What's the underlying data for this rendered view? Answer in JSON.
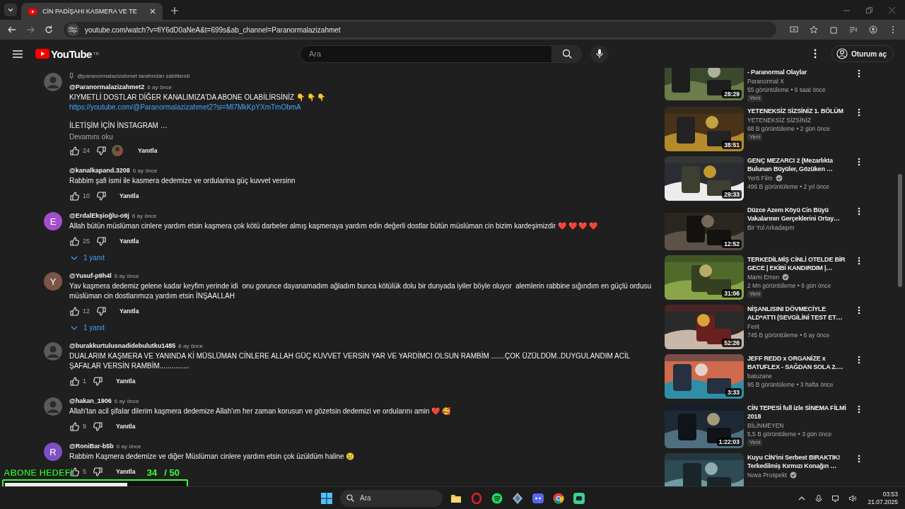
{
  "browser": {
    "tabs": [
      {
        "title": "CİN PADİŞAHI KASMERA VE TE",
        "selected": true
      }
    ],
    "url": "youtube.com/watch?v=fiY6dD0aNeA&t=699s&ab_channel=Paranormalazizahmet"
  },
  "header": {
    "logo": "YouTube",
    "region": "TR",
    "search": {
      "placeholder": "Ara"
    },
    "sign_in": "Oturum aç"
  },
  "comments": [
    {
      "pinned": "@paranormalazizahmet tarafından sabitlendi",
      "author": "@Paranormalazizahmet2",
      "age": "6 ay önce",
      "lines": [
        {
          "kind": "text",
          "text": "KIYMETLİ DOSTLAR DİĞER KANALIMIZA'DA ABONE OLABİLİRSİNİZ 👇 👇 👇"
        },
        {
          "kind": "link",
          "text": "https://youtube.com/@Paranormalazizahmet2?si=Ml7MkKpYXmTmObmA"
        },
        {
          "kind": "text",
          "text": "İLETİŞİM İÇİN İNSTAGRAM …",
          "gap_before": true
        }
      ],
      "more": "Devamını oku",
      "likes": "24",
      "creator_heart": true,
      "reply": "Yanıtla"
    },
    {
      "author": "@kanalkapand.3208",
      "age": "6 ay önce",
      "lines": [
        {
          "kind": "text",
          "text": "Rabbim şafi ismi ile kasmera dedemize ve ordularina güç kuvvet versinn"
        }
      ],
      "likes": "10",
      "creator_heart": false,
      "reply": "Yanıtla"
    },
    {
      "avatar": {
        "kind": "letter",
        "letter": "E",
        "color": "#a34fcb"
      },
      "author": "@ErdalEkşioğlu-o9j",
      "age": "6 ay önce",
      "lines": [
        {
          "kind": "text",
          "text": "Allah bütün müslüman cinlere yardım etsin kaşmera çok kötü darbeler almış kaşmeraya yardım edin değerli dostlar bütün müslüman cin bizim kardeşimizdir ❤️ ❤️ ❤️ ❤️"
        }
      ],
      "likes": "25",
      "creator_heart": false,
      "reply": "Yanıtla",
      "replies": "1 yanıt"
    },
    {
      "avatar": {
        "kind": "letter",
        "letter": "Y",
        "color": "#7a5548"
      },
      "author": "@Yusuf-p9h4l",
      "age": "6 ay önce",
      "lines": [
        {
          "kind": "text",
          "text": "Yav kaşmera dedemiz gelene kadar keyfim yerinde idi  onu gorunce dayanamadım ağladım bunca kötülük dolu bir dunyada iyiler böyle oluyor  alemlerin rabbine sığındım en güçlü ordusu müslüman cin dostlarımıza yardım etsin İNŞAALLAH"
        }
      ],
      "likes": "12",
      "creator_heart": false,
      "reply": "Yanıtla",
      "replies": "1 yanıt"
    },
    {
      "author": "@burakkurtulusnadidebulutku1485",
      "age": "6 ay önce",
      "lines": [
        {
          "kind": "text",
          "text": "DUALARIM KAŞMERA VE YANINDA Kİ MÜSLÜMAN CİNLERE ALLAH GÜÇ KUVVET VERSİN YAR VE YARDİMCI OLSUN RAMBİM .......ÇOK ÜZÜLDÜM..DUYGULANDIM ACİL ŞAFALAR VERSİN RAMBİM..............."
        }
      ],
      "likes": "1",
      "creator_heart": false,
      "reply": "Yanıtla"
    },
    {
      "author": "@hakan_1906",
      "age": "6 ay önce",
      "lines": [
        {
          "kind": "text",
          "text": "Allah'tan acil şifalar dilerim kaşmera dedemize Allah'ım her zaman korusun ve gözetsin dedemizi ve ordularını amin ❤️ 🥰"
        }
      ],
      "likes": "9",
      "creator_heart": false,
      "reply": "Yanıtla"
    },
    {
      "avatar": {
        "kind": "letter",
        "letter": "R",
        "color": "#7c4fc4"
      },
      "author": "@RoniBar-b5b",
      "age": "6 ay önce",
      "lines": [
        {
          "kind": "text",
          "text": "Rabbim Kaşmera dedemize ve diğer Müslüman cinlere yardım etsin çok üzüldüm haline 😢"
        }
      ],
      "likes": "5",
      "creator_heart": false,
      "reply": "Yanıtla"
    }
  ],
  "sidebar": {
    "videos": [
      {
        "title": "- Paranormal Olaylar",
        "channel": "Paranormal X",
        "verified": false,
        "meta": "55 görüntüleme • 6 saat önce",
        "badge": "Yeni",
        "duration": "28:29"
      },
      {
        "title": "YETENEKSİZ SİZSİNİZ 1. BÖLÜM",
        "channel": "YETENEKSİZ SİZSİNİZ",
        "verified": false,
        "meta": "68 B görüntüleme • 2 gün önce",
        "badge": "Yeni",
        "duration": "38:51"
      },
      {
        "title": "GENÇ MEZARCI 2 (Mezarlıkta Bulunan Büyüler, Gözüken …",
        "channel": "Yer6 Film",
        "verified": true,
        "meta": "496 B görüntüleme • 2 yıl önce",
        "duration": "29:33"
      },
      {
        "title": "Düzce Azem Köyü Cin Büyü Vakalarının Gerçeklerini Ortay…",
        "channel": "Bir Yol Arkadaşım",
        "verified": false,
        "duration": "12:52"
      },
      {
        "title": "TERKEDİLMİŞ CİNLİ OTELDE BİR GECE | EKİBİ KANDIRDIM |…",
        "channel": "Mami Emen",
        "verified": true,
        "meta": "2 Mn görüntüleme • 6 gün önce",
        "badge": "Yeni",
        "duration": "31:06"
      },
      {
        "title": "NİŞANLISINI DÖVMECİYLE ALD*ATTI (SEVGİLİNİ TEST ET…",
        "channel": "Ferit",
        "verified": false,
        "meta": "745 B görüntüleme • 6 ay önce",
        "duration": "52:26"
      },
      {
        "title": "JEFF REDD x ORGANİZE x BATUFLEX - SAĞDAN SOLA 2.…",
        "channel": "batuzane",
        "verified": false,
        "meta": "95 B görüntüleme • 3 hafta önce",
        "duration": "3:33"
      },
      {
        "title": "CİN TEPESİ full izle SİNEMA FİLMİ 2018",
        "channel": "BİLİNMEYEN",
        "verified": false,
        "meta": "5,5 B görüntüleme • 3 gün önce",
        "badge": "Yeni",
        "duration": "1:22:03"
      },
      {
        "title": "Kuyu CİN'ini Serbest BIRAKTIK! Terkedilmiş Kırmızı Konağın …",
        "channel": "Nova Prospekt",
        "verified": true
      }
    ]
  },
  "overlay": {
    "title": "ABONE HEDEFİ",
    "count": "34",
    "goal": "/ 50",
    "level": 0.68
  },
  "taskbar": {
    "search": {
      "placeholder": "Ara"
    },
    "time": "03:53",
    "date": "21.07.2025"
  }
}
